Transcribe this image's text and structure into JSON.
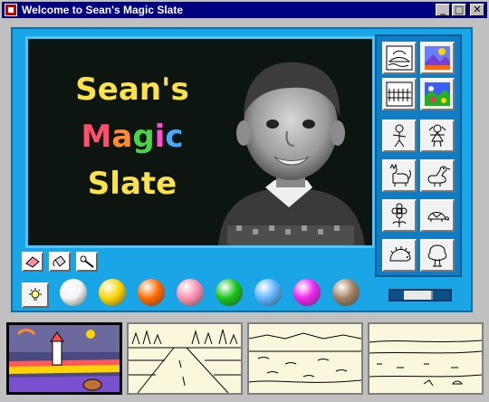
{
  "window": {
    "title": "Welcome to Sean's Magic Slate",
    "min_glyph": "_",
    "max_glyph": "□",
    "close_glyph": "✕"
  },
  "slate": {
    "title_lines": [
      "Sean's",
      "Magic",
      "Slate"
    ],
    "letter_colors": {
      "line1": [
        "#ffe14a",
        "#ffe14a",
        "#ffe14a",
        "#ffe14a",
        "#ffe14a",
        "#ffe14a"
      ],
      "line2": [
        "#ff4f6a",
        "#ff8a30",
        "#4cd34c",
        "#ff4fd0",
        "#4aa8ff"
      ],
      "line3": [
        "#ffe14a",
        "#ffe14a",
        "#ffe14a",
        "#ffe14a",
        "#ffe14a"
      ]
    },
    "background": "#0c150f"
  },
  "stamps": [
    {
      "name": "scene-boat-stamp",
      "icon": "boat-scene-icon"
    },
    {
      "name": "scene-color-landscape-stamp",
      "icon": "colored-landscape-icon"
    },
    {
      "name": "scene-fence-stamp",
      "icon": "fence-scene-icon"
    },
    {
      "name": "scene-color-garden-stamp",
      "icon": "colored-garden-icon"
    },
    {
      "name": "boy-stamp",
      "icon": "boy-icon"
    },
    {
      "name": "girl-stamp",
      "icon": "girl-icon"
    },
    {
      "name": "cat-stamp",
      "icon": "cat-icon"
    },
    {
      "name": "goose-stamp",
      "icon": "goose-icon"
    },
    {
      "name": "flower-stamp",
      "icon": "flower-icon"
    },
    {
      "name": "turtle-stamp",
      "icon": "turtle-icon"
    },
    {
      "name": "hedgehog-stamp",
      "icon": "hedgehog-icon"
    },
    {
      "name": "tree-stamp",
      "icon": "tree-icon"
    }
  ],
  "tools": [
    {
      "name": "eraser-tool",
      "icon": "eraser-icon"
    },
    {
      "name": "paint-bucket-tool",
      "icon": "paint-bucket-icon"
    },
    {
      "name": "magic-wand-tool",
      "icon": "magic-wand-icon"
    },
    {
      "name": "light-tool",
      "icon": "lightbulb-icon"
    }
  ],
  "colors": [
    {
      "name": "white",
      "hex": "#f4f4f4"
    },
    {
      "name": "yellow",
      "hex": "#ffd400"
    },
    {
      "name": "orange",
      "hex": "#ff6a00"
    },
    {
      "name": "pink",
      "hex": "#ff8fb0"
    },
    {
      "name": "green",
      "hex": "#19c219"
    },
    {
      "name": "light-blue",
      "hex": "#5fb4ff"
    },
    {
      "name": "magenta",
      "hex": "#ee22ee"
    },
    {
      "name": "tan",
      "hex": "#a08060"
    }
  ],
  "slider": {
    "value_fraction": 0.45
  },
  "thumbnails": [
    {
      "name": "thumbnail-lighthouse",
      "selected": true
    },
    {
      "name": "thumbnail-forest-road",
      "selected": false
    },
    {
      "name": "thumbnail-lake",
      "selected": false
    },
    {
      "name": "thumbnail-field",
      "selected": false
    }
  ]
}
